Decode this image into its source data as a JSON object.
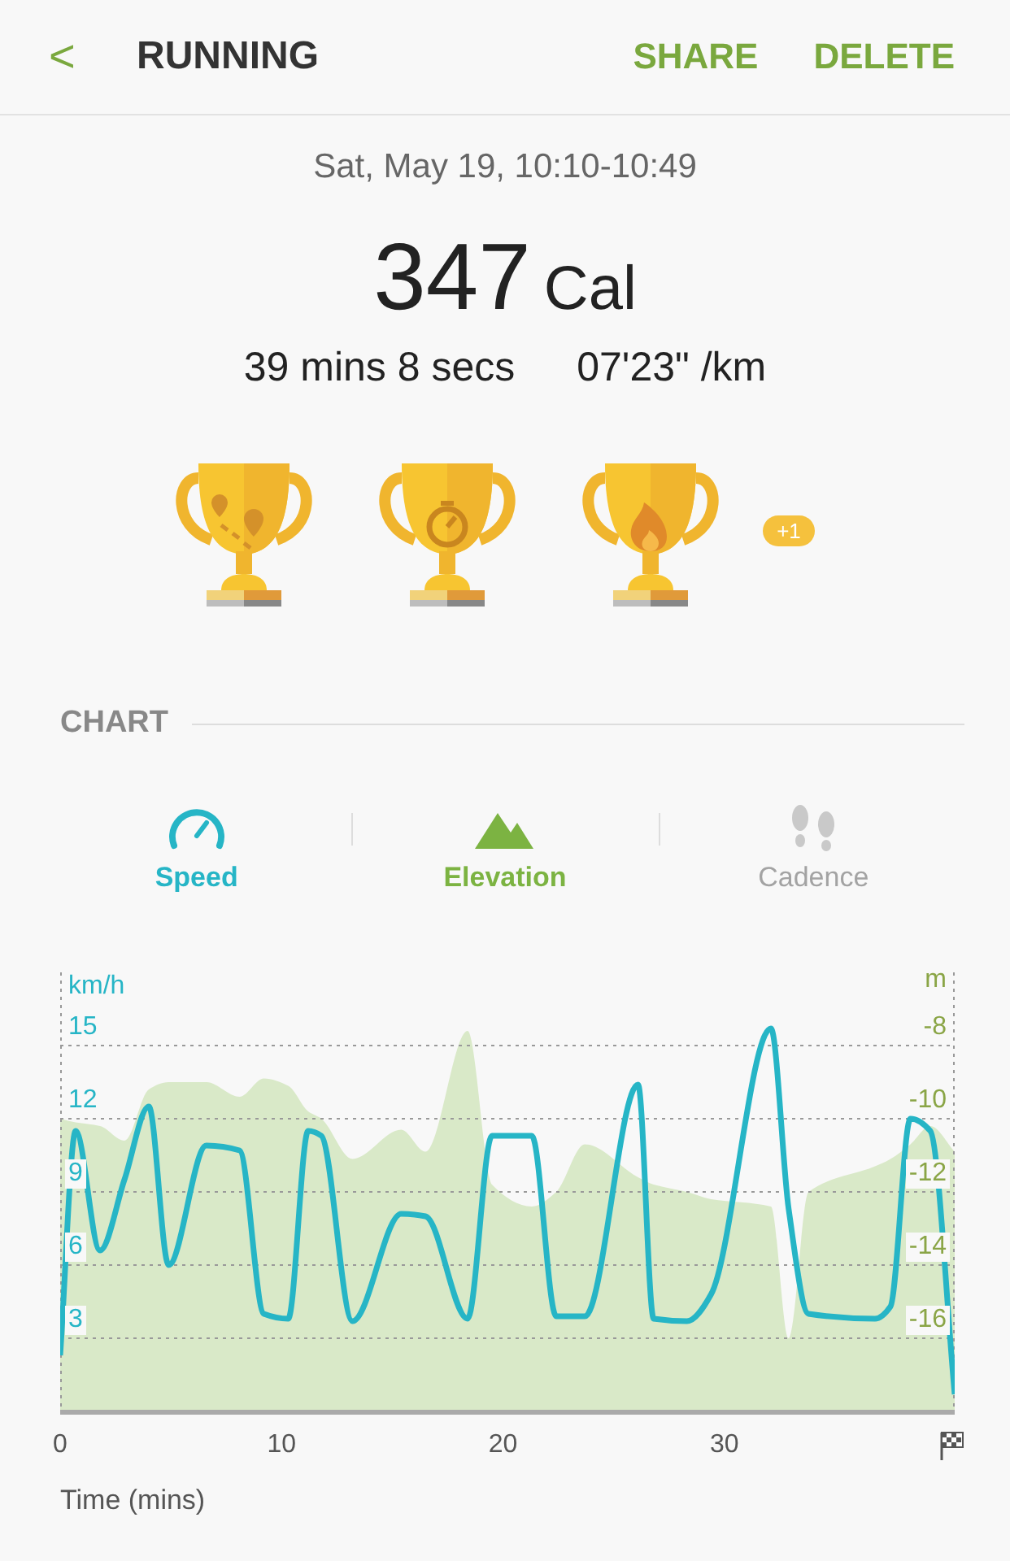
{
  "header": {
    "back": "<",
    "title": "RUNNING",
    "actions": [
      "SHARE",
      "DELETE"
    ]
  },
  "date": "Sat, May 19, 10:10-10:49",
  "calories": {
    "value": "347",
    "unit": "Cal"
  },
  "stats": [
    "39 mins 8 secs",
    "07'23\" /km"
  ],
  "trophies": [
    {
      "kind": "route"
    },
    {
      "kind": "stopwatch"
    },
    {
      "kind": "flame"
    }
  ],
  "trophy_more": "+1",
  "chart_section": {
    "title": "CHART",
    "tabs": [
      {
        "label": "Speed",
        "kind": "speed",
        "selected": true,
        "color": "#26b5c6"
      },
      {
        "label": "Elevation",
        "kind": "elevation",
        "selected": true,
        "color": "#7cb342"
      },
      {
        "label": "Cadence",
        "kind": "cadence",
        "selected": false,
        "color": "#a3a3a3"
      }
    ],
    "speed_chart": {
      "chart_data": {
        "type": "line",
        "xlabel": "Time (mins)",
        "ylabel": "km/h",
        "xlim": [
          0,
          40.4
        ],
        "ylim": [
          0,
          18
        ],
        "xticks": [
          0,
          10,
          20,
          30
        ],
        "yticks": [
          3,
          6,
          9,
          12,
          15
        ],
        "grid": true,
        "x": [
          0,
          0.7,
          1.8,
          2.9,
          4.0,
          4.9,
          6.6,
          8.1,
          9.2,
          10.3,
          11.2,
          11.8,
          13.2,
          15.4,
          16.5,
          18.4,
          19.5,
          21.3,
          22.4,
          23.7,
          26.1,
          26.8,
          28.3,
          29.4,
          32.1,
          32.9,
          33.8,
          36.8,
          37.5,
          38.4,
          39.3,
          40.4
        ],
        "series": [
          {
            "color": "#26b5c6",
            "values": [
              2.3,
              11.5,
              6.6,
              9.5,
              12.5,
              6,
              10.9,
              10.7,
              4,
              3.8,
              11.5,
              11.3,
              3.7,
              8.1,
              8,
              3.8,
              11.3,
              11.3,
              3.9,
              3.9,
              13.4,
              3.8,
              3.7,
              4.8,
              15.7,
              8.3,
              4,
              3.8,
              4.3,
              12,
              11.5,
              0.7
            ]
          }
        ]
      }
    },
    "elevation_chart": {
      "chart_data": {
        "type": "area",
        "ylabel": "m",
        "xlim": [
          0,
          40.4
        ],
        "ylim": [
          -18,
          -6
        ],
        "yticks": [
          -8,
          -10,
          -12,
          -14,
          -16
        ],
        "x": [
          0,
          0.7,
          1.8,
          2.9,
          4.0,
          4.9,
          6.6,
          8.1,
          9.2,
          10.3,
          11.2,
          11.8,
          13.2,
          15.4,
          16.5,
          18.4,
          19.5,
          21.3,
          22.4,
          23.7,
          26.1,
          26.8,
          28.3,
          29.4,
          32.1,
          32.9,
          33.8,
          36.8,
          37.5,
          38.4,
          39.3,
          40.4
        ],
        "series": [
          {
            "color": "#d9e9c8",
            "values": [
              -10,
              -10.1,
              -10.2,
              -10.6,
              -9.2,
              -9,
              -9,
              -9.4,
              -8.9,
              -9.1,
              -9.8,
              -10,
              -11.1,
              -10.3,
              -10.9,
              -7.6,
              -11.8,
              -12.4,
              -12,
              -10.7,
              -11.6,
              -11.8,
              -12,
              -12.2,
              -12.4,
              -16,
              -12,
              -11.3,
              -11.1,
              -10.7,
              -10.2,
              -10.9
            ]
          }
        ]
      }
    }
  }
}
